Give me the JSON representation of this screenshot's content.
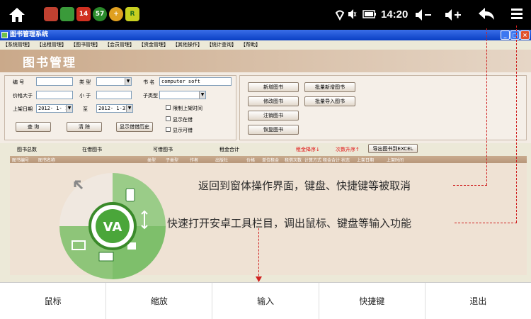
{
  "statusbar": {
    "time": "14:20",
    "app_badges": [
      "14",
      "57",
      "R"
    ]
  },
  "window": {
    "title": "图书管理系统",
    "menu": [
      "【系统管理】",
      "【出租管理】",
      "【图书管理】",
      "【会员管理】",
      "【资金管理】",
      "【其他操作】",
      "【统计查询】",
      "【帮助】"
    ],
    "banner_title": "图书管理"
  },
  "form": {
    "label_id": "编  号",
    "label_type": "类  型",
    "label_book_name": "书  名",
    "book_name_value": "computer soft",
    "label_price_gt": "价格大于",
    "label_lt": "小  于",
    "label_subtype": "子类型",
    "label_date": "上架日期",
    "date_from": "2012- 1- 1",
    "label_to": "至",
    "date_to": "2012- 1-31",
    "cb_limit_date": "限制上架时间",
    "cb_show_instock": "显示在借",
    "cb_show_available": "显示可借",
    "btn_query": "查 询",
    "btn_clear": "清 除",
    "btn_history": "显示借借历史",
    "btn_add": "新增图书",
    "btn_batch_add": "批量新增图书",
    "btn_edit": "修改图书",
    "btn_batch_import": "批量导入图书",
    "btn_cancel": "注销图书",
    "btn_restore": "恢复图书"
  },
  "stats": {
    "total": "图书总数",
    "borrowed": "在借图书",
    "available": "可借图书",
    "rent_total": "租金合计",
    "rent_desc": "租金降序↓",
    "count_asc": "次数升序↑",
    "export": "导出图书到EXCEL"
  },
  "table": {
    "columns": [
      "图书编号",
      "图书名称",
      "类型",
      "子类型",
      "作者",
      "出版社",
      "价格",
      "单位租金",
      "租借次数",
      "计算方式",
      "租金合计",
      "状态",
      "上架日期",
      "上架时间"
    ]
  },
  "annotations": {
    "back_hint": "返回到窗体操作界面，键盘、快捷键等被取消",
    "menu_hint": "快速打开安卓工具栏目，调出鼠标、键盘等输入功能"
  },
  "bottom_menu": [
    "鼠标",
    "缩放",
    "输入",
    "快捷键",
    "退出"
  ],
  "colors": {
    "title_bar": "#0a3fc4",
    "banner": "#caa98a",
    "annotation_line": "#d02020",
    "wheel_green": "#4aa63a"
  }
}
